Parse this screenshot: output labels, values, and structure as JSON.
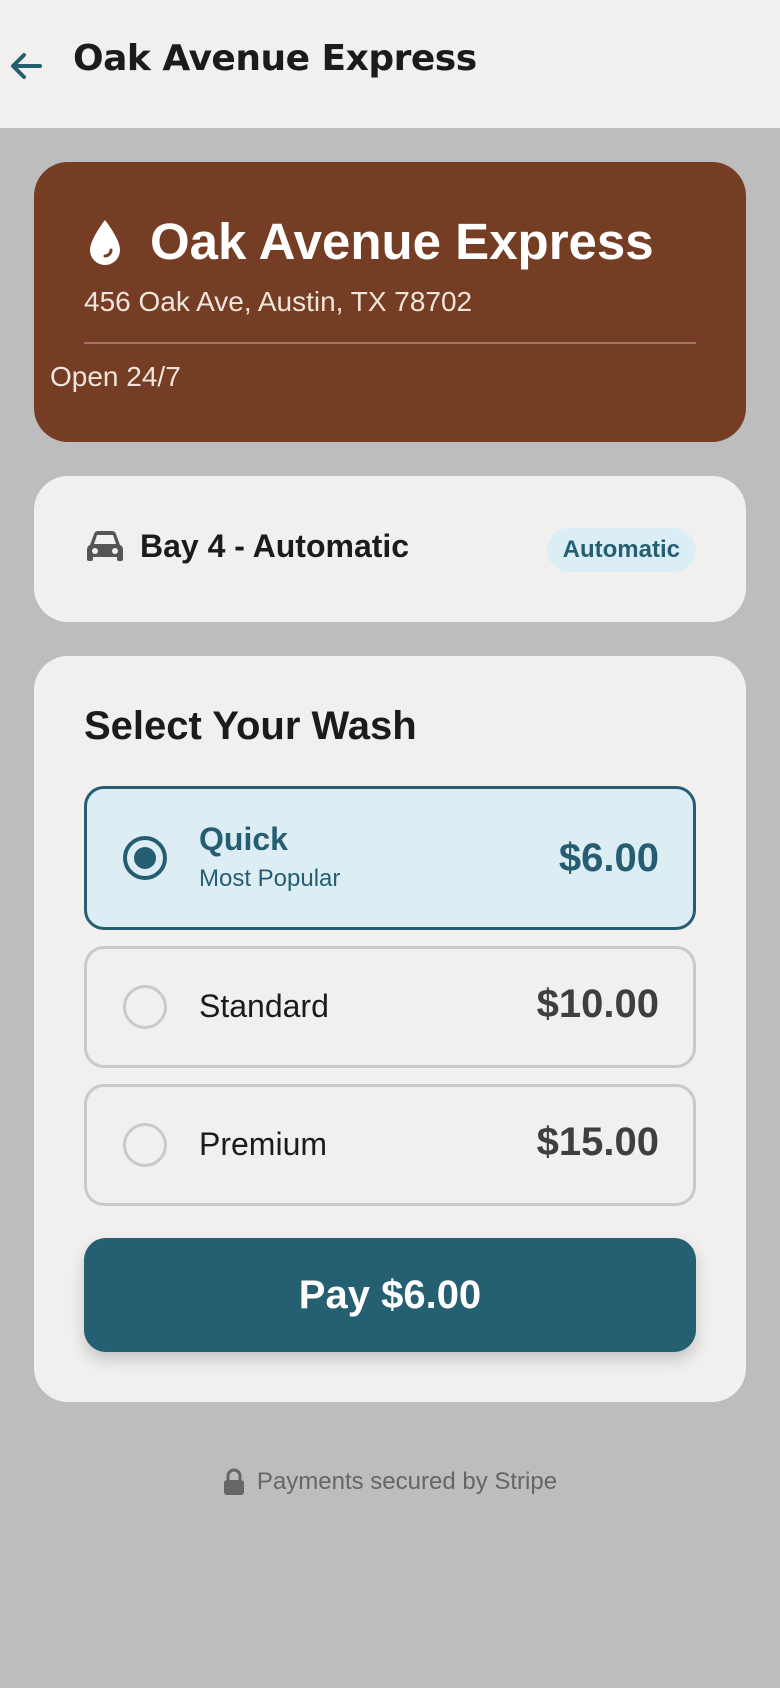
{
  "header": {
    "title": "Oak Avenue Express",
    "back_icon": "arrow-left-icon"
  },
  "location": {
    "name": "Oak Avenue Express",
    "address": "456 Oak Ave, Austin, TX 78702",
    "hours": "Open 24/7",
    "icon": "water-drop-icon"
  },
  "bay": {
    "name": "Bay 4 - Automatic",
    "badge": "Automatic",
    "icon": "car-icon"
  },
  "wash_selection": {
    "title": "Select Your Wash",
    "options": [
      {
        "label": "Quick",
        "subtitle": "Most Popular",
        "price": "$6.00",
        "selected": true
      },
      {
        "label": "Standard",
        "price": "$10.00",
        "selected": false
      },
      {
        "label": "Premium",
        "price": "$15.00",
        "selected": false
      }
    ]
  },
  "pay_button": {
    "label": "Pay $6.00"
  },
  "footer": {
    "text": "Payments secured by Stripe",
    "icon": "lock-icon"
  },
  "colors": {
    "primary": "#245f72",
    "location_card": "#743d24",
    "page_background": "#bcbdbc",
    "card_background": "#f2f0ef"
  }
}
